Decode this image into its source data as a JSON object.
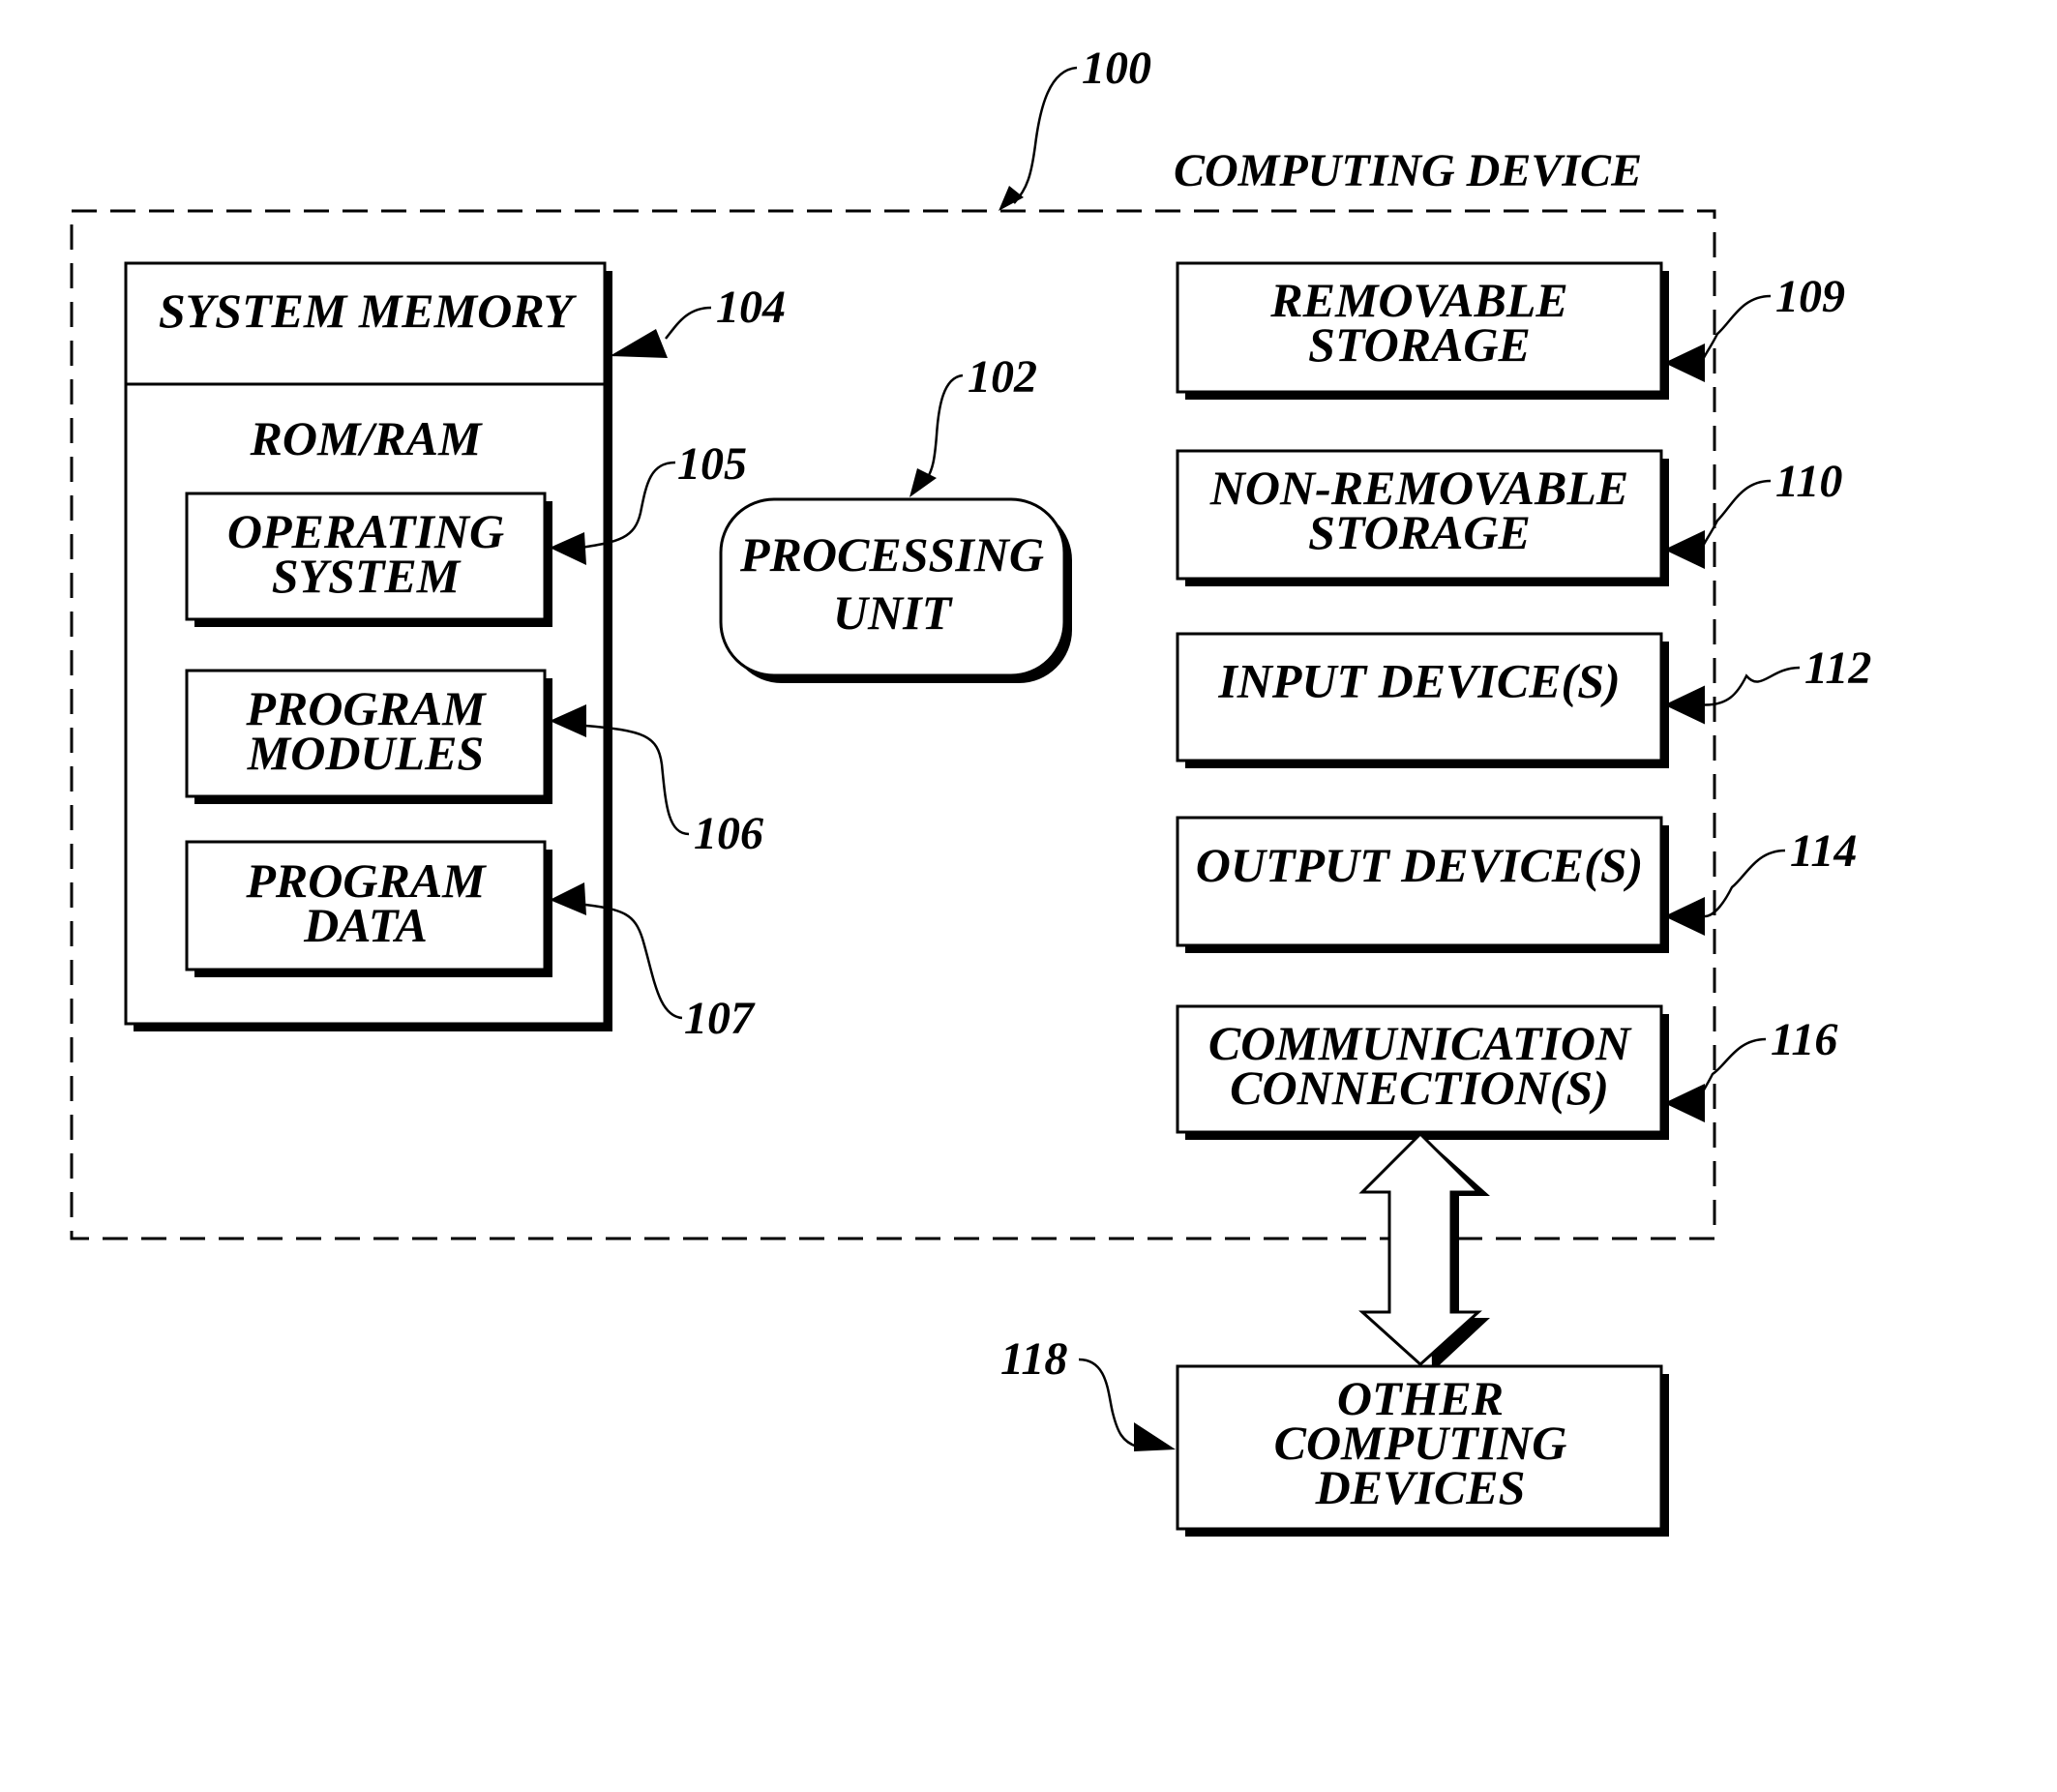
{
  "figure": {
    "ref": "100",
    "title": "COMPUTING DEVICE"
  },
  "system_memory": {
    "ref": "104",
    "title": "SYSTEM MEMORY",
    "subtitle": "ROM/RAM",
    "children": [
      {
        "ref": "105",
        "lines": [
          "OPERATING",
          "SYSTEM"
        ]
      },
      {
        "ref": "106",
        "lines": [
          "PROGRAM",
          "MODULES"
        ]
      },
      {
        "ref": "107",
        "lines": [
          "PROGRAM",
          "DATA"
        ]
      }
    ]
  },
  "processing_unit": {
    "ref": "102",
    "lines": [
      "PROCESSING",
      "UNIT"
    ]
  },
  "right_components": [
    {
      "ref": "109",
      "lines": [
        "REMOVABLE",
        "STORAGE"
      ]
    },
    {
      "ref": "110",
      "lines": [
        "NON-REMOVABLE",
        "STORAGE"
      ]
    },
    {
      "ref": "112",
      "lines": [
        "INPUT DEVICE(S)"
      ]
    },
    {
      "ref": "114",
      "lines": [
        "OUTPUT DEVICE(S)"
      ]
    },
    {
      "ref": "116",
      "lines": [
        "COMMUNICATION",
        "CONNECTION(S)"
      ]
    }
  ],
  "other_devices": {
    "ref": "118",
    "lines": [
      "OTHER",
      "COMPUTING",
      "DEVICES"
    ]
  }
}
